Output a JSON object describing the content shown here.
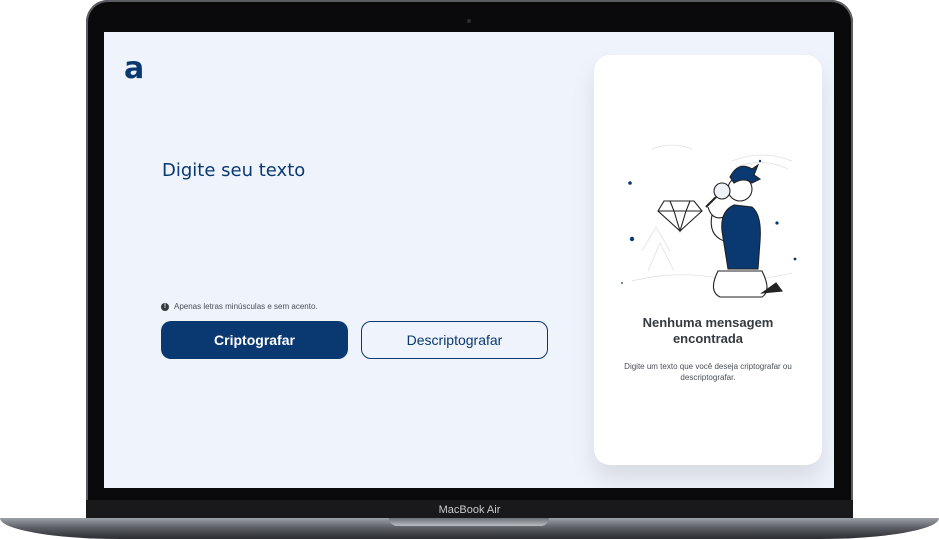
{
  "device": {
    "label": "MacBook Air"
  },
  "app": {
    "logo_text": "a",
    "input": {
      "placeholder": "Digite seu texto",
      "value": ""
    },
    "hint": {
      "icon": "info-icon",
      "text": "Apenas letras minúsculas e sem acento."
    },
    "buttons": {
      "encrypt_label": "Criptografar",
      "decrypt_label": "Descriptografar"
    },
    "result_panel": {
      "title": "Nenhuma mensagem encontrada",
      "description": "Digite um texto que você deseja criptografar ou descriptografar.",
      "illustration": "person-magnifying-diamond-illustration"
    }
  },
  "colors": {
    "brand": "#0a3871",
    "screen_background": "#eff3fb",
    "card_background": "#ffffff"
  }
}
